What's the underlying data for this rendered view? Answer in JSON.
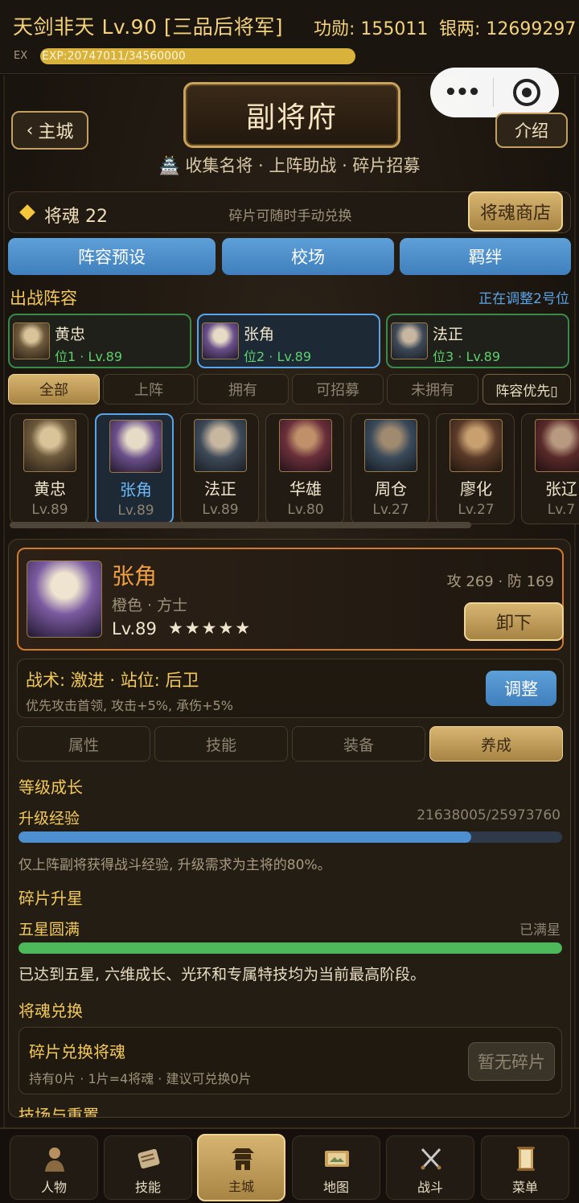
{
  "status": {
    "player": "天剑非天 Lv.90 [三品后将军]",
    "merit": "功勋: 155011",
    "silver": "银两: 12699297",
    "ex_label": "EX",
    "exp_text": "EXP:20747011/34560000",
    "exp_progress": 0.6
  },
  "header": {
    "back_label": "主城",
    "title": "副将府",
    "intro_label": "介绍",
    "subtitle": "🏯 收集名将 · 上阵助战 · 碎片招募"
  },
  "soul": {
    "label": "将魂 22",
    "hint": "碎片可随时手动兑换",
    "shop_label": "将魂商店"
  },
  "main_tabs": [
    "阵容预设",
    "校场",
    "羁绊"
  ],
  "lineup": {
    "title": "出战阵容",
    "status": "正在调整2号位",
    "slots": [
      {
        "name": "黄忠",
        "info": "位1 · Lv.89"
      },
      {
        "name": "张角",
        "info": "位2 · Lv.89"
      },
      {
        "name": "法正",
        "info": "位3 · Lv.89"
      }
    ]
  },
  "filters": [
    "全部",
    "上阵",
    "拥有",
    "可招募",
    "未拥有"
  ],
  "sort_label": "阵容优先▯",
  "heroes": [
    {
      "name": "黄忠",
      "level": "Lv.89"
    },
    {
      "name": "张角",
      "level": "Lv.89"
    },
    {
      "name": "法正",
      "level": "Lv.89"
    },
    {
      "name": "华雄",
      "level": "Lv.80"
    },
    {
      "name": "周仓",
      "level": "Lv.27"
    },
    {
      "name": "廖化",
      "level": "Lv.27"
    },
    {
      "name": "张辽",
      "level": "Lv.7"
    }
  ],
  "detail": {
    "name": "张角",
    "type": "橙色 · 方士",
    "level": "Lv.89",
    "stars": "★★★★★",
    "star_count": 5,
    "stats": "攻 269 · 防 169",
    "unequip_label": "卸下",
    "tactic_title": "战术: 激进 · 站位: 后卫",
    "tactic_desc": "优先攻击首领, 攻击+5%, 承伤+5%",
    "adjust_label": "调整",
    "tabs": [
      "属性",
      "技能",
      "装备",
      "养成"
    ],
    "growth_title": "等级成长",
    "exp_label": "升级经验",
    "exp_value": "21638005/25973760",
    "exp_progress": 0.833,
    "exp_note": "仅上阵副将获得战斗经验, 升级需求为主将的80%。",
    "star_title": "碎片升星",
    "star_label": "五星圆满",
    "star_value": "已满星",
    "star_progress": 1.0,
    "star_note": "已达到五星, 六维成长、光环和专属特技均为当前最高阶段。",
    "soul_title": "将魂兑换",
    "swap_title": "碎片兑换将魂",
    "swap_desc": "持有0片 · 1片=4将魂 · 建议可兑换0片",
    "swap_button": "暂无碎片",
    "next_title": "技场与重置"
  },
  "nav": [
    {
      "label": "人物",
      "icon": "character-icon"
    },
    {
      "label": "技能",
      "icon": "scroll-icon"
    },
    {
      "label": "主城",
      "icon": "castle-icon"
    },
    {
      "label": "地图",
      "icon": "map-icon"
    },
    {
      "label": "战斗",
      "icon": "crossed-swords-icon"
    },
    {
      "label": "菜单",
      "icon": "menu-scroll-icon"
    }
  ],
  "colors": {
    "gold": "#f3c95a",
    "blue": "#5aa4e8",
    "green": "#4cb85a",
    "orange": "#f0a040"
  }
}
